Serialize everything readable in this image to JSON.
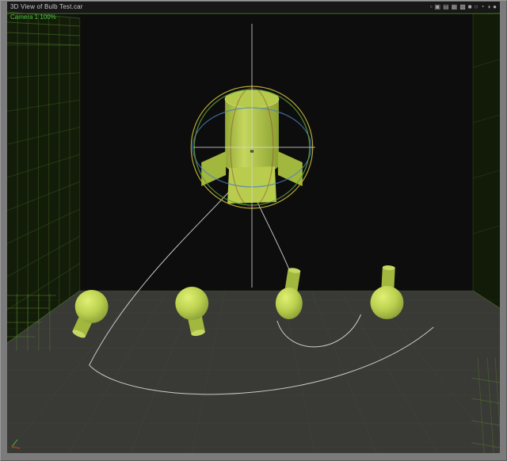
{
  "window": {
    "title": "3D View of Bulb Test.car",
    "toolbar_icons": [
      {
        "name": "bounding-box-preview-icon",
        "glyph": "▫"
      },
      {
        "name": "wireframe-preview-icon",
        "glyph": "▣"
      },
      {
        "name": "lit-wireframe-preview-icon",
        "glyph": "▤"
      },
      {
        "name": "flat-preview-icon",
        "glyph": "▦"
      },
      {
        "name": "gouraud-preview-icon",
        "glyph": "▩"
      },
      {
        "name": "phong-preview-icon",
        "glyph": "■"
      },
      {
        "name": "sphere-wireframe-preview-icon",
        "glyph": "○"
      },
      {
        "name": "sphere-flat-preview-icon",
        "glyph": "◔"
      },
      {
        "name": "sphere-shaded-preview-icon",
        "glyph": "◑"
      },
      {
        "name": "sphere-textured-preview-icon",
        "glyph": "●"
      }
    ]
  },
  "viewport": {
    "camera_label": "Camera 1 100%"
  },
  "colors": {
    "frame_gray": "#7b7b7b",
    "titlebar_bg": "#181818",
    "viewport_bg": "#101010",
    "edge_green": "#54842c",
    "grid_green": "#55822c",
    "object_lime": "#b9cc4d",
    "object_lime_mid": "#a2b73d",
    "object_lime_dark": "#8ba030",
    "gizmo_yellow": "#c2b13a",
    "gizmo_green": "#5f9e3a",
    "gizmo_blue": "#4b7fc0",
    "gizmo_red": "#8a3a32",
    "crosshair_white": "#d8d8d8",
    "path_white": "#e4e4e4",
    "camera_label_green": "#4fc447"
  }
}
